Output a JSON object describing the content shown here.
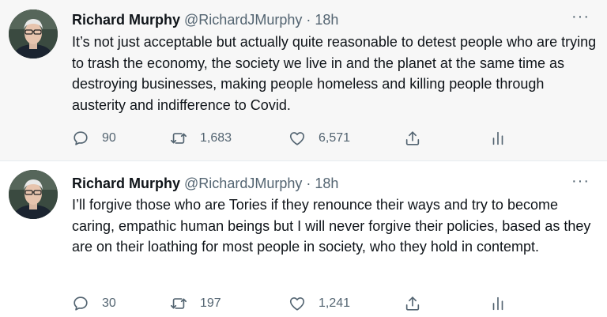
{
  "tweets": [
    {
      "name": "Richard Murphy",
      "handle": "@RichardJMurphy",
      "sep": "·",
      "time": "18h",
      "text": "It’s not just acceptable but actually quite reasonable to detest people who are trying to trash the economy, the society we live in and the planet at the same time as destroying businesses, making people homeless and killing people through austerity and indifference to Covid.",
      "replies": "90",
      "retweets": "1,683",
      "likes": "6,571",
      "more": "···"
    },
    {
      "name": "Richard Murphy",
      "handle": "@RichardJMurphy",
      "sep": "·",
      "time": "18h",
      "text": "I’ll forgive those who are Tories if they renounce their ways and try to become caring, empathic human beings but I will never forgive their policies, based as they are on their loathing for most people in society, who they hold in contempt.",
      "replies": "30",
      "retweets": "197",
      "likes": "1,241",
      "more": "···"
    }
  ],
  "icons": {
    "reply": "speech-bubble-icon",
    "retweet": "retweet-arrows-icon",
    "like": "heart-icon",
    "share": "share-upload-icon",
    "analytics": "bar-chart-icon"
  },
  "colors": {
    "text": "#0f1419",
    "muted": "#536471",
    "highlight_bg": "#f7f7f7",
    "thread_line": "#cfd9de"
  }
}
